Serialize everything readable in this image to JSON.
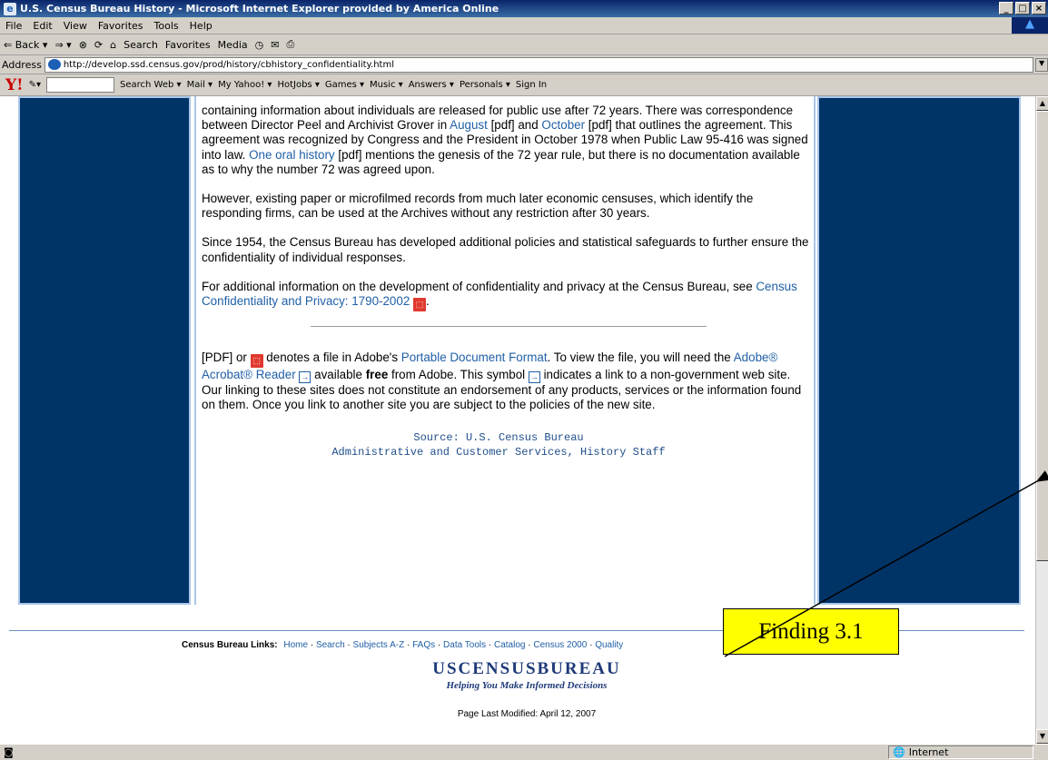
{
  "window": {
    "title": "U.S. Census Bureau History - Microsoft Internet Explorer provided by America Online"
  },
  "menubar": {
    "items": [
      "File",
      "Edit",
      "View",
      "Favorites",
      "Tools",
      "Help"
    ]
  },
  "toolbar": {
    "back": "⇐ Back ▾",
    "forward": "⇒ ▾",
    "search": "Search",
    "favorites": "Favorites",
    "media": "Media"
  },
  "address": {
    "label": "Address",
    "url": "http://develop.ssd.census.gov/prod/history/cbhistory_confidentiality.html"
  },
  "yahoo": {
    "search_web": "Search Web ▾",
    "mail": "Mail ▾",
    "my_yahoo": "My Yahoo! ▾",
    "hotjobs": "HotJobs ▾",
    "games": "Games ▾",
    "music": "Music ▾",
    "answers": "Answers ▾",
    "personals": "Personals ▾",
    "sign_in": "Sign In"
  },
  "body": {
    "p1_a": "containing information about individuals are released for public use after 72 years. There was correspondence between Director Peel and Archivist Grover in ",
    "p1_link_august": "August",
    "p1_b": " [pdf] and ",
    "p1_link_october": "October",
    "p1_c": " [pdf] that outlines the agreement. This agreement was recognized by Congress and the President in October 1978 when Public Law 95-416 was signed into law. ",
    "p1_link_oral": "One oral history",
    "p1_d": " [pdf] mentions the genesis of the 72 year rule, but there is no documentation available as to why the number 72 was agreed upon.",
    "p2": "However, existing paper or microfilmed records from much later economic censuses, which identify the responding firms, can be used at the Archives without any restriction after 30 years.",
    "p3": "Since 1954, the Census Bureau has developed additional policies and statistical safeguards to further ensure the confidentiality of individual responses.",
    "p4_a": "For additional information on the development of confidentiality and privacy at the Census Bureau, see ",
    "p4_link": "Census Confidentiality and Privacy:  1790-2002",
    "p4_b": ".",
    "p5_a": "[PDF] or ",
    "p5_b": " denotes a file in Adobe's ",
    "p5_link_pdf": "Portable Document Format",
    "p5_c": ". To view the file, you will need the ",
    "p5_link_reader": "Adobe® Acrobat® Reader",
    "p5_d": " available ",
    "p5_free": "free",
    "p5_e": " from Adobe. This symbol ",
    "p5_f": " indicates a link to a non-government web site. Our linking to these sites does not constitute an endorsement of any products, services or the information found on them. Once you link to another site you are subject to the policies of the new site.",
    "source_line1": "Source: U.S. Census Bureau",
    "source_line2": "Administrative and Customer Services, History Staff"
  },
  "footer": {
    "links_label": "Census Bureau Links:",
    "links": [
      "Home",
      "Search",
      "Subjects A-Z",
      "FAQs",
      "Data Tools",
      "Catalog",
      "Census 2000",
      "Quality"
    ],
    "brand": "USCENSUSBUREAU",
    "tagline": "Helping You Make Informed Decisions",
    "modified": "Page Last Modified: April 12, 2007"
  },
  "callout": {
    "text": "Finding 3.1"
  },
  "statusbar": {
    "zone": "Internet"
  }
}
